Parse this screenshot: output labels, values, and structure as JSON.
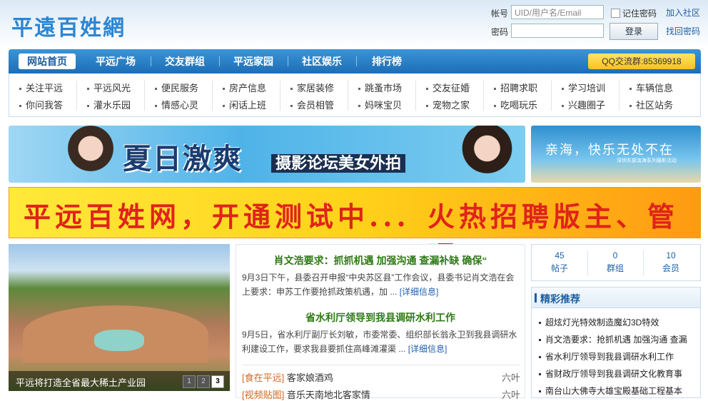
{
  "site": {
    "logo_text": "平遠百姓網"
  },
  "login": {
    "account_label": "帐号",
    "account_placeholder": "UID/用户名/Email",
    "password_label": "密码",
    "remember_label": "记住密码",
    "login_button": "登录",
    "join_link": "加入社区",
    "recover_link": "找回密码"
  },
  "nav": {
    "items": [
      "网站首页",
      "平远广场",
      "交友群组",
      "平远家园",
      "社区娱乐",
      "排行榜"
    ],
    "qq_group": "QQ交流群:85369918"
  },
  "subnav": {
    "row1": [
      "关注平远",
      "平远风光",
      "便民服务",
      "房产信息",
      "家居装修",
      "跳蚤市场",
      "交友征婚",
      "招聘求职",
      "学习培训",
      "车辆信息"
    ],
    "row2": [
      "你问我答",
      "灌水乐园",
      "情感心灵",
      "闲话上班",
      "会员相管",
      "妈咪宝贝",
      "宠物之家",
      "吃喝玩乐",
      "兴趣圈子",
      "社区站务"
    ]
  },
  "banners": {
    "summer_title": "夏日激爽",
    "summer_sub": "摄影论坛美女外拍",
    "beach_text": "亲海，快乐无处不在",
    "beach_sub": "深圳东部滨海系列摄影活动",
    "recruit_left": "平远百姓网，开通测试中...",
    "recruit_right": "火热招聘版主、管理"
  },
  "slideshow": {
    "caption": "平远将打造全省最大稀土产业园",
    "pages": [
      "1",
      "2",
      "3"
    ]
  },
  "news": {
    "headline1": "肖文浩要求：抓抓机遇 加强沟通 查漏补缺 确保“",
    "body1": "9月3日下午，县委召开申报“中央苏区县”工作会议，县委书记肖文浩在会上要求：申苏工作要抢抓政策机遇，加 ...",
    "headline2": "省水利厅领导到我县调研水利工作",
    "body2": "9月5日，省水利厅副厅长刘敏，市委常委、组织部长翁永卫到我县调研水利建设工作，要求我县要抓住高峰滩灌渠 ...",
    "more": "[详细信息]",
    "list": [
      {
        "category": "[食在平远]",
        "title": "客家娘酒鸡",
        "author": "六叶"
      },
      {
        "category": "[视频贴图]",
        "title": "音乐天南地北客家情",
        "author": "六叶"
      }
    ]
  },
  "stats": [
    {
      "value": "45",
      "label": "帖子"
    },
    {
      "value": "0",
      "label": "群组"
    },
    {
      "value": "10",
      "label": "会员"
    }
  ],
  "recommend": {
    "title": "精彩推荐",
    "items": [
      "超炫灯光特效制造魔幻3D特效",
      "肖文浩要求：抢抓机遇 加强沟通 查漏",
      "省水利厅领导到我县调研水利工作",
      "省财政厅领导到我县调研文化教育事",
      "南台山大佛寺大雄宝殿基础工程基本"
    ]
  }
}
